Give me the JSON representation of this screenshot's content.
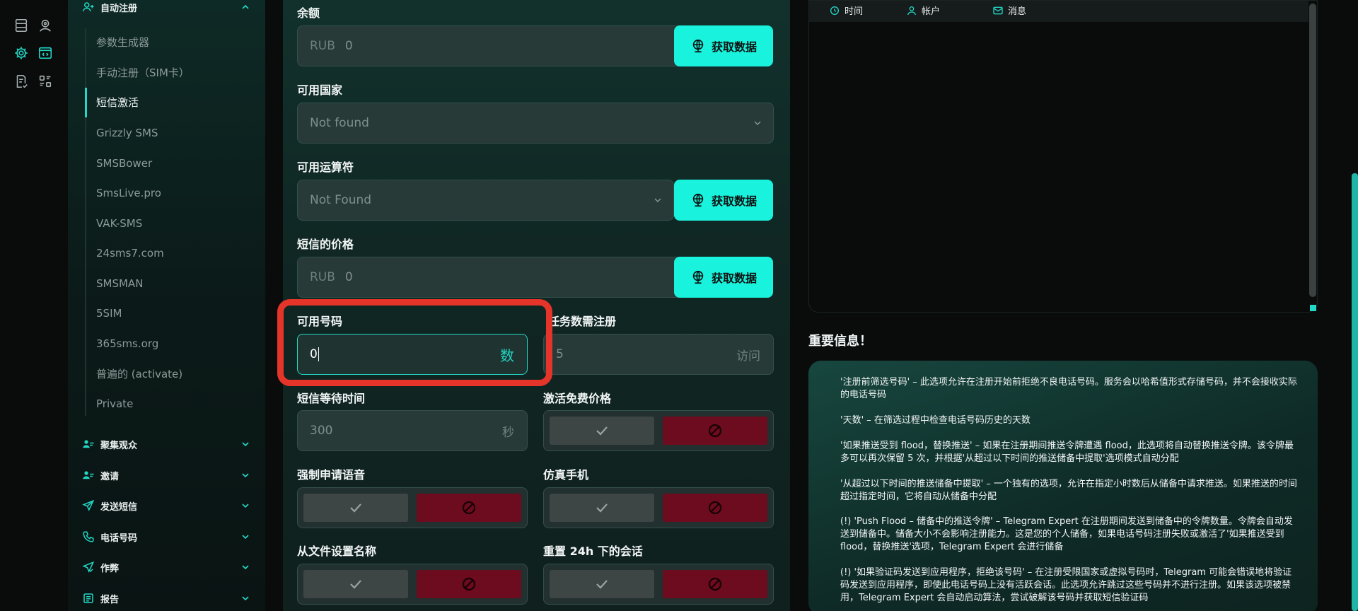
{
  "sidebar": {
    "section_auto_register": "自动注册",
    "sub_items": [
      "参数生成器",
      "手动注册（SIM卡）",
      "短信激活",
      "Grizzly SMS",
      "SMSBower",
      "SmsLive.pro",
      "VAK-SMS",
      "24sms7.com",
      "SMSMAN",
      "5SIM",
      "365sms.org",
      "普遍的 (activate)",
      "Private"
    ],
    "sections": [
      "聚集观众",
      "邀请",
      "发送短信",
      "电话号码",
      "作弊",
      "报告"
    ]
  },
  "form": {
    "balance_label": "余额",
    "balance_prefix": "RUB",
    "balance_value": "0",
    "fetch_label": "获取数据",
    "country_label": "可用国家",
    "country_value": "Not found",
    "operator_label": "可用运算符",
    "operator_value": "Not Found",
    "sms_price_label": "短信的价格",
    "sms_price_prefix": "RUB",
    "sms_price_value": "0",
    "available_numbers_label": "可用号码",
    "available_numbers_value": "0",
    "available_numbers_suffix": "数",
    "tasks_label": "任务数需注册",
    "tasks_value": "5",
    "tasks_suffix": "访问",
    "sms_wait_label": "短信等待时间",
    "sms_wait_value": "300",
    "sms_wait_suffix": "秒",
    "free_price_label": "激活免费价格",
    "force_voice_label": "强制申请语音",
    "emulate_phone_label": "仿真手机",
    "name_from_file_label": "从文件设置名称",
    "reset_sessions_label": "重置 24h 下的会话"
  },
  "log": {
    "tab_time": "时间",
    "tab_account": "帐户",
    "tab_message": "消息"
  },
  "info": {
    "title": "重要信息！",
    "paragraphs": [
      "'注册前筛选号码' – 此选项允许在注册开始前拒绝不良电话号码。服务会以哈希值形式存储号码，并不会接收实际的电话号码",
      "'天数' – 在筛选过程中检查电话号码历史的天数",
      "'如果推送受到 flood，替换推送' – 如果在注册期间推送令牌遭遇 flood，此选项将自动替换推送令牌。该令牌最多可以再次保留 5 次，并根据'从超过以下时间的推送储备中提取'选项模式自动分配",
      "'从超过以下时间的推送储备中提取' – 一个独有的选项，允许在指定小时数后从储备中请求推送。如果推送的时间超过指定时间，它将自动从储备中分配",
      "(!) 'Push Flood – 储备中的推送令牌' – Telegram Expert 在注册期间发送到储备中的令牌数量。令牌会自动发送到储备中。储备大小不会影响注册能力。这是您的个人储备，如果电话号码注册失败或激活了'如果推送受到 flood，替换推送'选项，Telegram Expert 会进行储备",
      "(!) '如果验证码发送到应用程序，拒绝该号码' – 在注册受限国家或虚拟号码时，Telegram 可能会错误地将验证码发送到应用程序，即使此电话号码上没有活跃会话。此选项允许跳过这些号码并不进行注册。如果该选项被禁用，Telegram Expert 会自动启动算法，尝试破解该号码并获取短信验证码"
    ]
  }
}
